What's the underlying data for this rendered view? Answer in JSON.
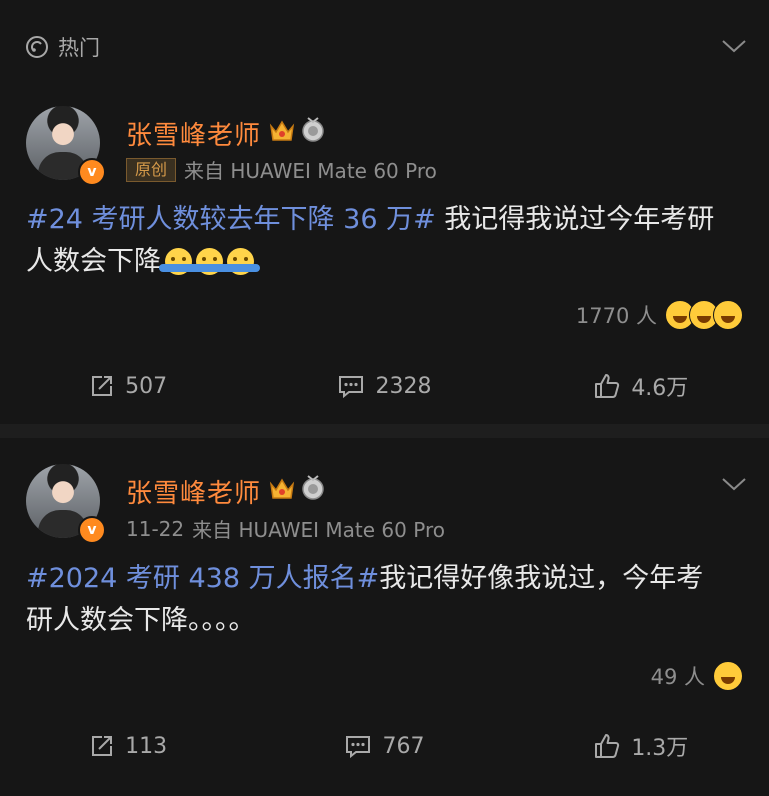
{
  "feed": {
    "section_label": "热门"
  },
  "posts": [
    {
      "username": "张雪峰老师",
      "badge_letter": "v",
      "tag_label": "原创",
      "source": "来自 HUAWEI Mate 60 Pro",
      "hashtag": "#24 考研人数较去年下降 36 万#",
      "text_line1": " 我记得我说过今年考研",
      "text_line2": "人数会下降",
      "reaction_count": "1770 人",
      "reposts": "507",
      "comments": "2328",
      "likes": "4.6万"
    },
    {
      "username": "张雪峰老师",
      "badge_letter": "v",
      "date": "11-22",
      "source": "来自 HUAWEI Mate 60 Pro",
      "hashtag": "#2024 考研 438 万人报名#",
      "text_line1": "我记得好像我说过，今年考",
      "text_line2": "研人数会下降。。。。",
      "reaction_count": "49 人",
      "reposts": "113",
      "comments": "767",
      "likes": "1.3万"
    }
  ],
  "colors": {
    "username": "#ff8a3d",
    "hashtag": "#6f8fdc",
    "background": "#161616"
  }
}
